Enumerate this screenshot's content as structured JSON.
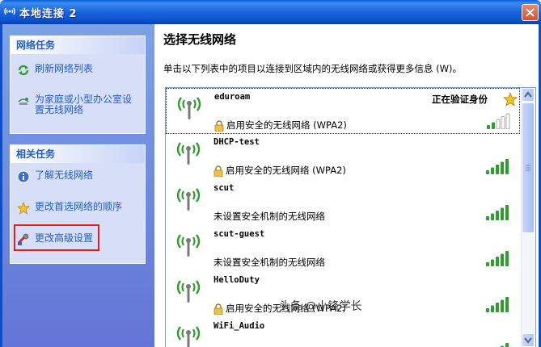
{
  "window": {
    "title": "本地连接 2"
  },
  "left": {
    "network_tasks": {
      "header": "网络任务",
      "items": [
        {
          "label": "刷新网络列表",
          "icon": "refresh-icon"
        },
        {
          "label": "为家庭或小型办公室设置无线网络",
          "icon": "home-network-icon"
        }
      ]
    },
    "related_tasks": {
      "header": "相关任务",
      "items": [
        {
          "label": "了解无线网络",
          "icon": "info-icon"
        },
        {
          "label": "更改首选网络的顺序",
          "icon": "star-icon"
        },
        {
          "label": "更改高级设置",
          "icon": "settings-icon"
        }
      ]
    }
  },
  "main": {
    "heading": "选择无线网络",
    "description": "单击以下列表中的项目以连接到区域内的无线网络或获得更多信息 (W)。",
    "networks": [
      {
        "name": "eduroam",
        "security": "启用安全的无线网络 (WPA2)",
        "secured": true,
        "status": "正在验证身份",
        "signal_bars": 2
      },
      {
        "name": "DHCP-test",
        "security": "启用安全的无线网络 (WPA2)",
        "secured": true,
        "signal_bars": 5
      },
      {
        "name": "scut",
        "security": "未设置安全机制的无线网络",
        "secured": false,
        "signal_bars": 5
      },
      {
        "name": "scut-guest",
        "security": "未设置安全机制的无线网络",
        "secured": false,
        "signal_bars": 5
      },
      {
        "name": "HelloDuty",
        "security": "启用安全的无线网络 (WPA2)",
        "secured": true,
        "signal_bars": 5
      },
      {
        "name": "WiFi_Audio",
        "security": "",
        "secured": false,
        "signal_bars": 5
      }
    ]
  },
  "watermark": "头条 @小锋学长",
  "colors": {
    "title_bar": "#0A5FD8",
    "task_link": "#215DC6",
    "signal_green": "#2E9E2E",
    "highlight_box": "#E02020"
  }
}
